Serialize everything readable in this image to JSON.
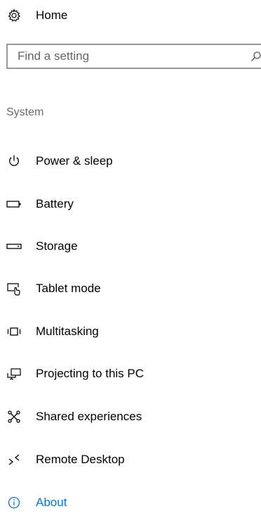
{
  "header": {
    "home_label": "Home",
    "home_icon": "gear-icon"
  },
  "search": {
    "placeholder": "Find a setting",
    "value": "",
    "icon": "search-icon"
  },
  "section": {
    "title": "System"
  },
  "nav": {
    "items": [
      {
        "label": "Power & sleep",
        "icon": "power-icon"
      },
      {
        "label": "Battery",
        "icon": "battery-icon"
      },
      {
        "label": "Storage",
        "icon": "storage-icon"
      },
      {
        "label": "Tablet mode",
        "icon": "tablet-mode-icon"
      },
      {
        "label": "Multitasking",
        "icon": "multitasking-icon"
      },
      {
        "label": "Projecting to this PC",
        "icon": "projecting-icon"
      },
      {
        "label": "Shared experiences",
        "icon": "shared-experiences-icon"
      },
      {
        "label": "Remote Desktop",
        "icon": "remote-desktop-icon"
      },
      {
        "label": "About",
        "icon": "info-icon"
      }
    ]
  },
  "colors": {
    "text": "#000000",
    "accent": "#0078d7",
    "section": "#6b6b6b",
    "search_border": "#999999"
  }
}
